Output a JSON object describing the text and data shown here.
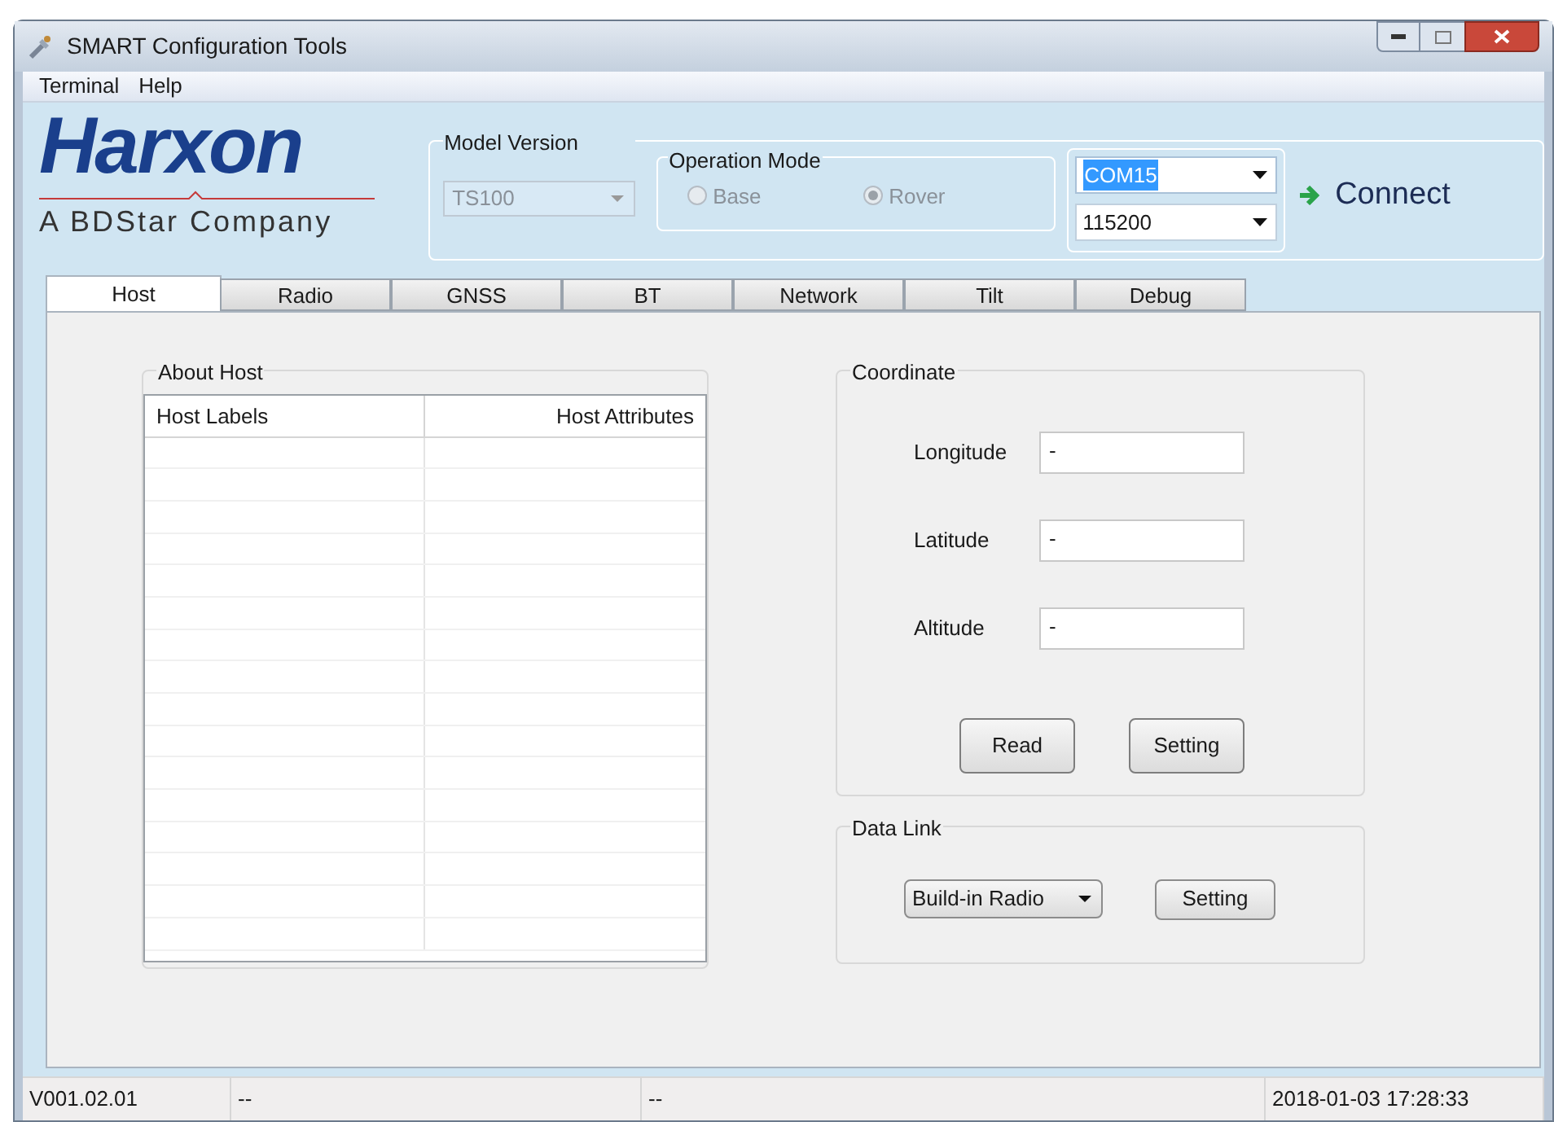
{
  "window": {
    "title": "SMART Configuration Tools"
  },
  "menu": [
    "Terminal",
    "Help"
  ],
  "logo": {
    "name": "Harxon",
    "tagline": "A BDStar Company"
  },
  "model_version": {
    "label": "Model Version",
    "value": "TS100",
    "disabled": true
  },
  "operation_mode": {
    "label": "Operation Mode",
    "disabled": true,
    "options": [
      {
        "label": "Base",
        "selected": false
      },
      {
        "label": "Rover",
        "selected": true
      }
    ]
  },
  "port": {
    "value": "COM15",
    "highlighted": true
  },
  "baud": {
    "value": "115200"
  },
  "connect": {
    "label": "Connect"
  },
  "tabs": [
    {
      "label": "Host",
      "selected": true
    },
    {
      "label": "Radio",
      "selected": false
    },
    {
      "label": "GNSS",
      "selected": false
    },
    {
      "label": "BT",
      "selected": false
    },
    {
      "label": "Network",
      "selected": false
    },
    {
      "label": "Tilt",
      "selected": false
    },
    {
      "label": "Debug",
      "selected": false
    }
  ],
  "about_host": {
    "title": "About Host",
    "columns": [
      "Host Labels",
      "Host Attributes"
    ]
  },
  "coordinate": {
    "title": "Coordinate",
    "fields": [
      {
        "label": "Longitude",
        "value": "-"
      },
      {
        "label": "Latitude",
        "value": "-"
      },
      {
        "label": "Altitude",
        "value": "-"
      }
    ],
    "buttons": [
      "Read",
      "Setting"
    ]
  },
  "data_link": {
    "title": "Data Link",
    "dropdown": "Build-in Radio",
    "button": "Setting"
  },
  "status_bar": [
    "V001.02.01",
    "--",
    "--",
    "2018-01-03 17:28:33"
  ]
}
